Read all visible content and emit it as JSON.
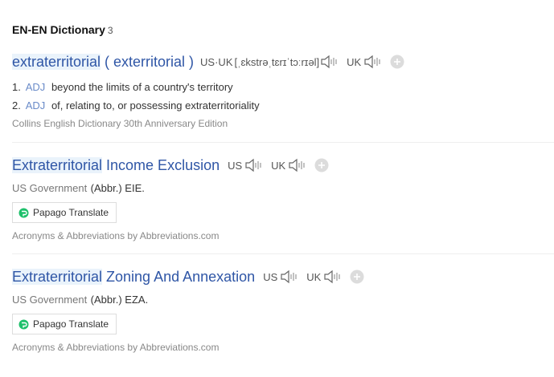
{
  "section": {
    "title": "EN-EN Dictionary",
    "count": "3"
  },
  "entries": [
    {
      "headword_highlight": "extraterritorial",
      "headword_rest": " ( exterritorial )",
      "pron_label": "US·UK",
      "ipa": "[ˌɛkstrəˌtɛrɪˈtɔːrɪəl]",
      "uk_label": "UK",
      "senses": [
        {
          "num": "1.",
          "pos": "ADJ",
          "text": "beyond the limits of a country's territory"
        },
        {
          "num": "2.",
          "pos": "ADJ",
          "text": "of, relating to, or possessing extraterritoriality"
        }
      ],
      "source": "Collins English Dictionary 30th Anniversary Edition"
    },
    {
      "headword_highlight": "Extraterritorial",
      "headword_rest": " Income Exclusion",
      "us_label": "US",
      "uk_label": "UK",
      "category": "US Government",
      "abbr": "(Abbr.) EIE.",
      "button": "Papago Translate",
      "source": "Acronyms & Abbreviations by Abbreviations.com"
    },
    {
      "headword_highlight": "Extraterritorial",
      "headword_rest": " Zoning And Annexation",
      "us_label": "US",
      "uk_label": "UK",
      "category": "US Government",
      "abbr": "(Abbr.) EZA.",
      "button": "Papago Translate",
      "source": "Acronyms & Abbreviations by Abbreviations.com"
    }
  ],
  "colors": {
    "link": "#2f56a6",
    "pos": "#6a8bc9",
    "highlight": "#eaf3fb",
    "papago": "#1ec06b"
  },
  "icons": {
    "speaker": "speaker-icon",
    "add": "plus-circle-icon",
    "papago": "papago-icon"
  }
}
